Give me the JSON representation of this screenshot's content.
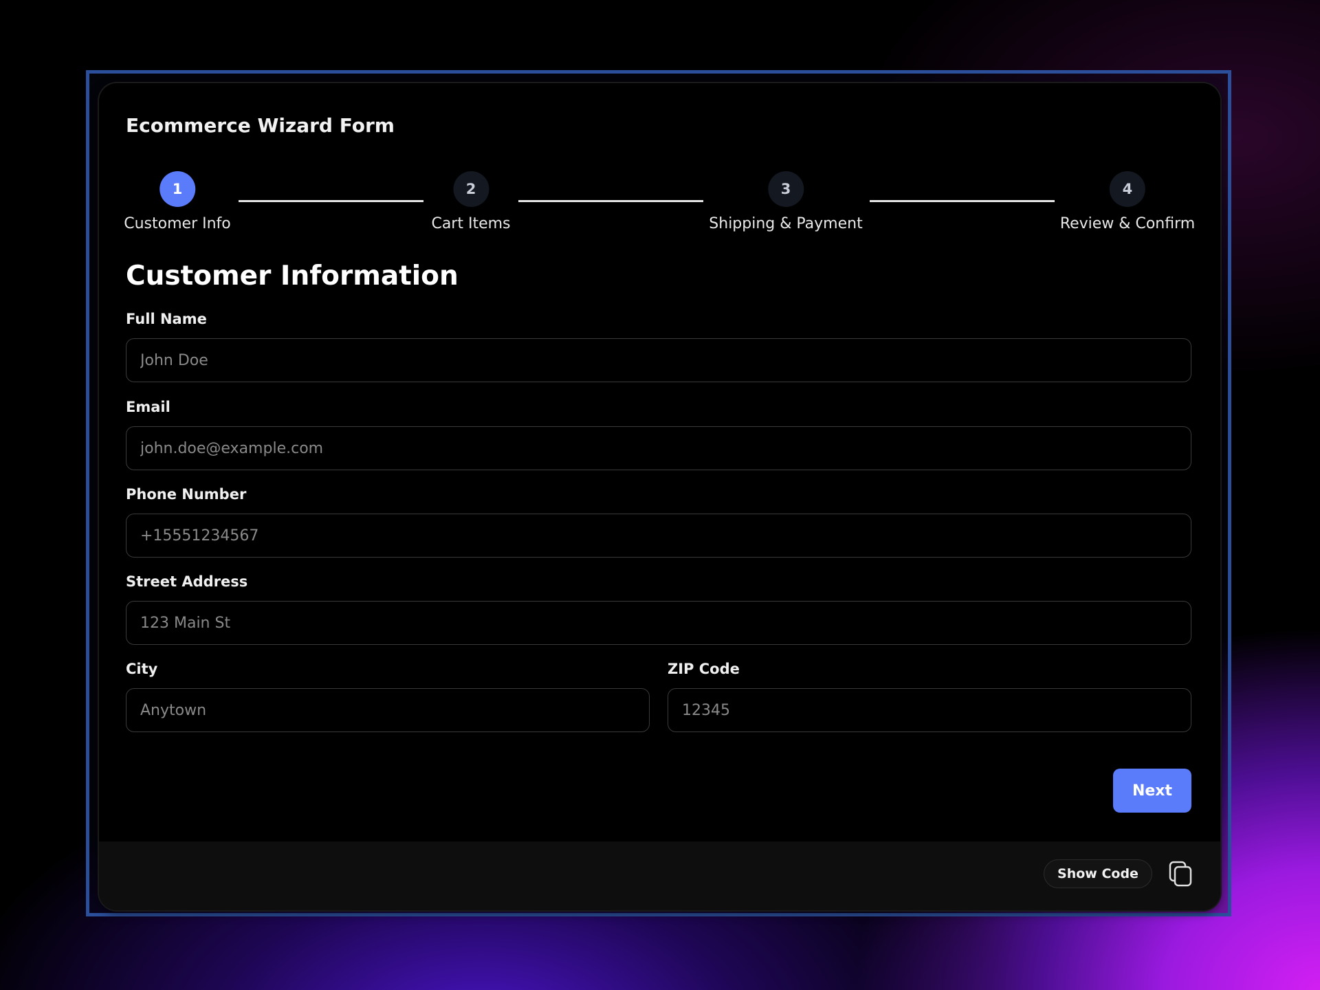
{
  "form": {
    "title": "Ecommerce Wizard Form",
    "active_step": 1
  },
  "steps": [
    {
      "number": "1",
      "label": "Customer Info",
      "active": true
    },
    {
      "number": "2",
      "label": "Cart Items",
      "active": false
    },
    {
      "number": "3",
      "label": "Shipping & Payment",
      "active": false
    },
    {
      "number": "4",
      "label": "Review & Confirm",
      "active": false
    }
  ],
  "section": {
    "title": "Customer Information"
  },
  "fields": {
    "full_name": {
      "label": "Full Name",
      "placeholder": "John Doe",
      "value": ""
    },
    "email": {
      "label": "Email",
      "placeholder": "john.doe@example.com",
      "value": ""
    },
    "phone": {
      "label": "Phone Number",
      "placeholder": "+15551234567",
      "value": ""
    },
    "street": {
      "label": "Street Address",
      "placeholder": "123 Main St",
      "value": ""
    },
    "city": {
      "label": "City",
      "placeholder": "Anytown",
      "value": ""
    },
    "zip": {
      "label": "ZIP Code",
      "placeholder": "12345",
      "value": ""
    }
  },
  "actions": {
    "next_label": "Next"
  },
  "footer": {
    "show_code_label": "Show Code",
    "copy_icon": "copy-icon"
  },
  "colors": {
    "accent": "#5b7cfa",
    "background": "#000000",
    "frame_border": "#2b4f9a"
  }
}
